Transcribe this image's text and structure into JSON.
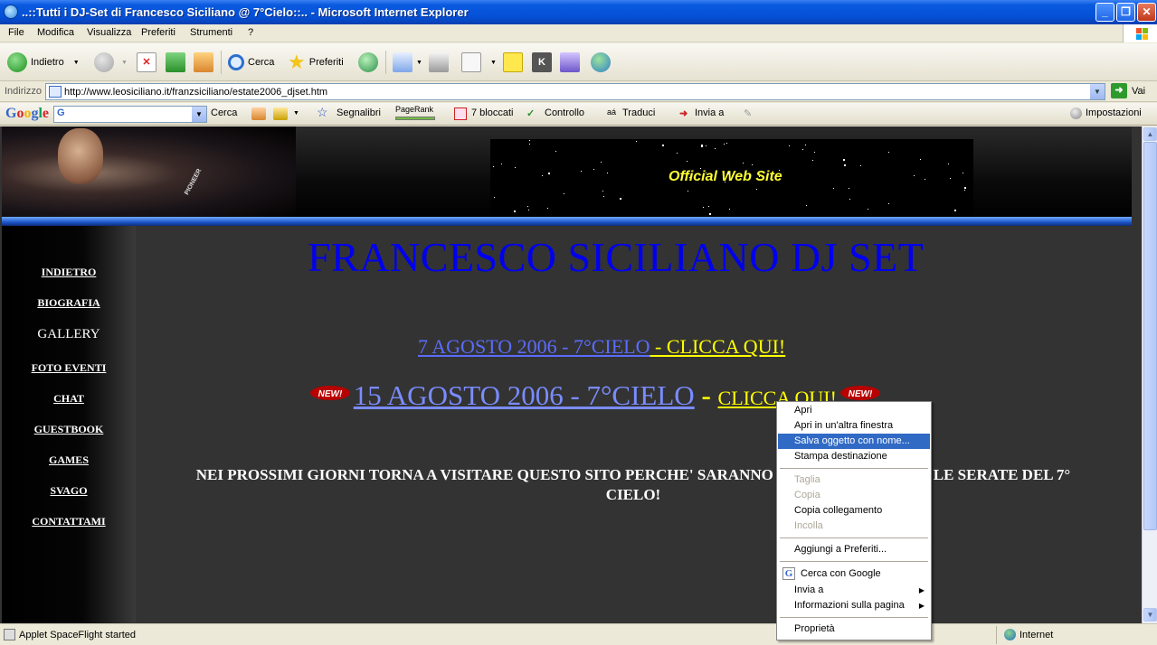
{
  "window": {
    "title": "..::Tutti i DJ-Set di Francesco Siciliano @ 7°Cielo::.. - Microsoft Internet Explorer"
  },
  "menubar": {
    "items": [
      "File",
      "Modifica",
      "Visualizza",
      "Preferiti",
      "Strumenti",
      "?"
    ]
  },
  "toolbar": {
    "back_label": "Indietro",
    "search_label": "Cerca",
    "favorites_label": "Preferiti"
  },
  "address": {
    "label": "Indirizzo",
    "url": "http://www.leosiciliano.it/franzsiciliano/estate2006_djset.htm",
    "go_label": "Vai"
  },
  "googlebar": {
    "logo": "Google",
    "search_label": "Cerca",
    "bookmarks_label": "Segnalibri",
    "pagerank_label": "PageRank",
    "blocked_label": "7 bloccati",
    "check_label": "Controllo",
    "translate_label": "Traduci",
    "send_label": "Invia a",
    "settings_label": "Impostazioni"
  },
  "page": {
    "official_label": "Official Web Site",
    "photo_brand": "PIONEER",
    "nav": [
      "INDIETRO",
      "BIOGRAFIA",
      "GALLERY",
      "FOTO EVENTI",
      "CHAT",
      "GUESTBOOK",
      "GAMES",
      "SVAGO",
      "CONTATTAMI"
    ],
    "title": "FRANCESCO SICILIANO DJ SET",
    "link1_text": "7 AGOSTO 2006 - 7°CIELO",
    "link1_cta": " - CLICCA QUI!",
    "link2_text": "15 AGOSTO 2006 - 7°CIELO",
    "link2_dash": " - ",
    "link2_cta": "CLICCA QUI!",
    "new_badge": "NEW!",
    "notice_line1": "NEI PROSSIMI GIORNI TORNA A VISITARE QUESTO SITO PERCHE' SARANNO DISPONIBILI TUTTE LE SERATE DEL 7°",
    "notice_line2": "CIELO!"
  },
  "context_menu": {
    "items": [
      {
        "label": "Apri",
        "state": "normal"
      },
      {
        "label": "Apri in un'altra finestra",
        "state": "normal"
      },
      {
        "label": "Salva oggetto con nome...",
        "state": "selected"
      },
      {
        "label": "Stampa destinazione",
        "state": "normal"
      },
      {
        "label": "Taglia",
        "state": "disabled"
      },
      {
        "label": "Copia",
        "state": "disabled"
      },
      {
        "label": "Copia collegamento",
        "state": "normal"
      },
      {
        "label": "Incolla",
        "state": "disabled"
      },
      {
        "label": "Aggiungi a Preferiti...",
        "state": "normal"
      },
      {
        "label": "Cerca con Google",
        "state": "normal"
      },
      {
        "label": "Invia a",
        "state": "submenu"
      },
      {
        "label": "Informazioni sulla pagina",
        "state": "submenu"
      },
      {
        "label": "Proprietà",
        "state": "normal"
      }
    ]
  },
  "statusbar": {
    "text": "Applet SpaceFlight started",
    "zone": "Internet"
  },
  "colors": {
    "selection": "#316ac5",
    "title_link": "#0000ee",
    "cta_yellow": "#ffff00",
    "official_yellow": "#ffff33"
  }
}
